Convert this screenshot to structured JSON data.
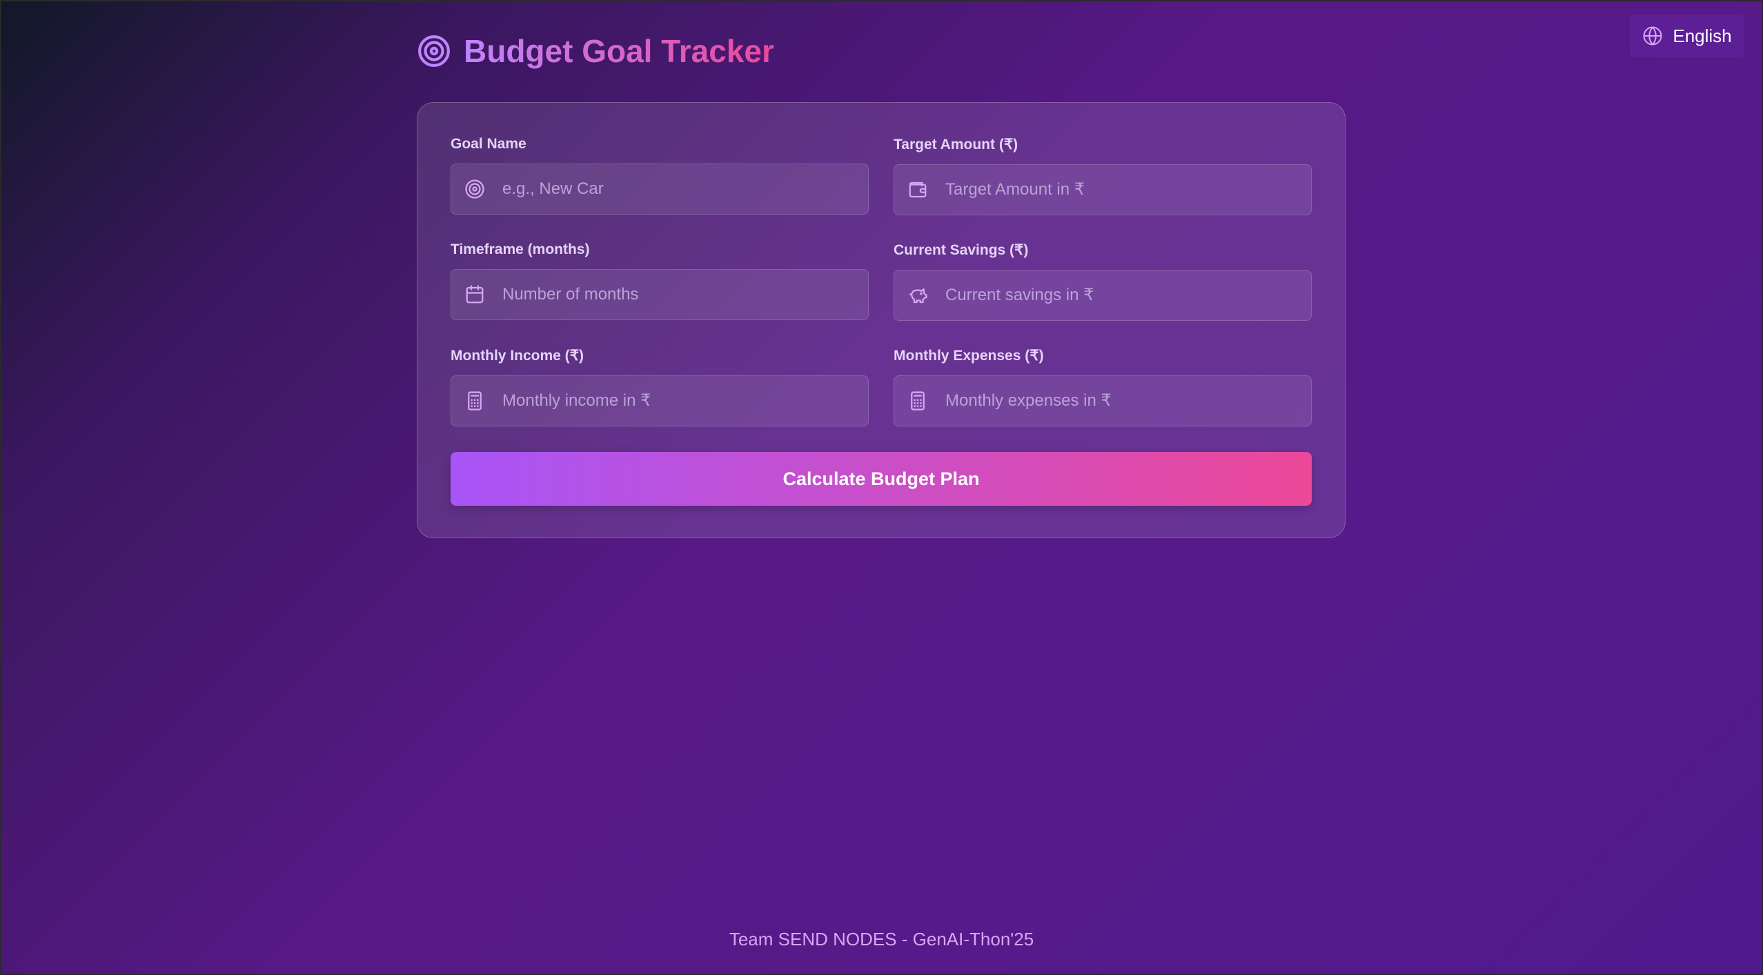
{
  "header": {
    "title": "Budget Goal Tracker",
    "icon": "target-icon"
  },
  "language": {
    "label": "English",
    "icon": "globe-icon"
  },
  "form": {
    "fields": [
      {
        "label": "Goal Name",
        "placeholder": "e.g., New Car",
        "value": "",
        "icon": "target-icon"
      },
      {
        "label": "Target Amount (₹)",
        "placeholder": "Target Amount in ₹",
        "value": "",
        "icon": "wallet-icon"
      },
      {
        "label": "Timeframe (months)",
        "placeholder": "Number of months",
        "value": "",
        "icon": "calendar-icon"
      },
      {
        "label": "Current Savings (₹)",
        "placeholder": "Current savings in ₹",
        "value": "",
        "icon": "piggy-bank-icon"
      },
      {
        "label": "Monthly Income (₹)",
        "placeholder": "Monthly income in ₹",
        "value": "",
        "icon": "calculator-icon"
      },
      {
        "label": "Monthly Expenses (₹)",
        "placeholder": "Monthly expenses in ₹",
        "value": "",
        "icon": "calculator-icon"
      }
    ],
    "submit_label": "Calculate Budget Plan"
  },
  "footer": {
    "text": "Team SEND NODES - GenAI-Thon'25"
  },
  "colors": {
    "accent_start": "#a855f7",
    "accent_end": "#ec4899",
    "icon": "#d8a7f5"
  }
}
